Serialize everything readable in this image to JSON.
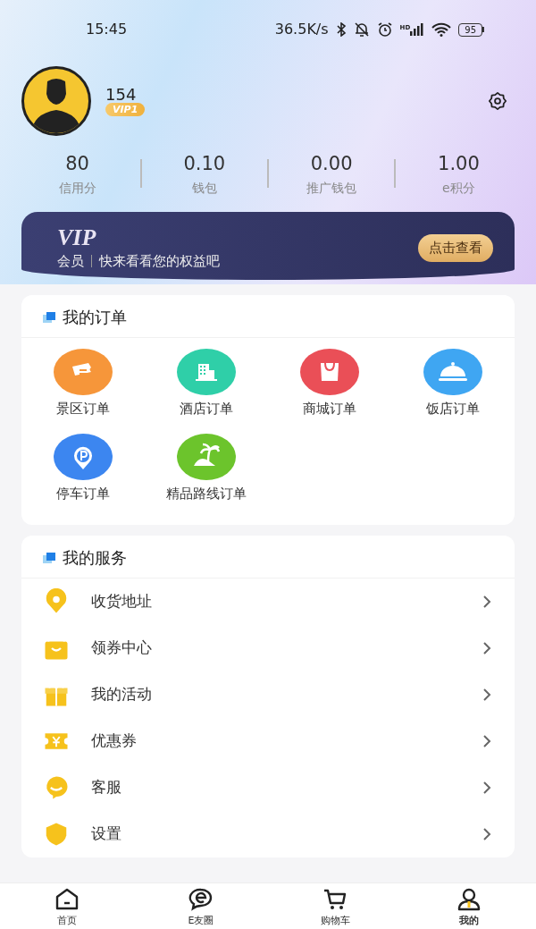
{
  "status_bar": {
    "time": "15:45",
    "speed": "36.5K/s",
    "signal_tag": "HD",
    "battery": "95"
  },
  "profile": {
    "name": "154",
    "vip_badge": "VIP1"
  },
  "stats": [
    {
      "value": "80",
      "label": "信用分"
    },
    {
      "value": "0.10",
      "label": "钱包"
    },
    {
      "value": "0.00",
      "label": "推广钱包"
    },
    {
      "value": "1.00",
      "label": "e积分"
    }
  ],
  "vip_banner": {
    "title": "VIP",
    "tag": "会员",
    "text": "快来看看您的权益吧",
    "button": "点击查看"
  },
  "orders": {
    "title": "我的订单",
    "items": [
      {
        "label": "景区订单",
        "color": "#f6963a"
      },
      {
        "label": "酒店订单",
        "color": "#2fcfa8"
      },
      {
        "label": "商城订单",
        "color": "#ea4f57"
      },
      {
        "label": "饭店订单",
        "color": "#3fa6f2"
      },
      {
        "label": "停车订单",
        "color": "#3c86f0"
      },
      {
        "label": "精品路线订单",
        "color": "#6cc42c"
      }
    ]
  },
  "services": {
    "title": "我的服务",
    "items": [
      {
        "label": "收货地址"
      },
      {
        "label": "领券中心"
      },
      {
        "label": "我的活动"
      },
      {
        "label": "优惠券"
      },
      {
        "label": "客服"
      },
      {
        "label": "设置"
      }
    ]
  },
  "tab_bar": [
    {
      "label": "首页",
      "selected": false
    },
    {
      "label": "E友圈",
      "selected": false
    },
    {
      "label": "购物车",
      "selected": false
    },
    {
      "label": "我的",
      "selected": true
    }
  ]
}
